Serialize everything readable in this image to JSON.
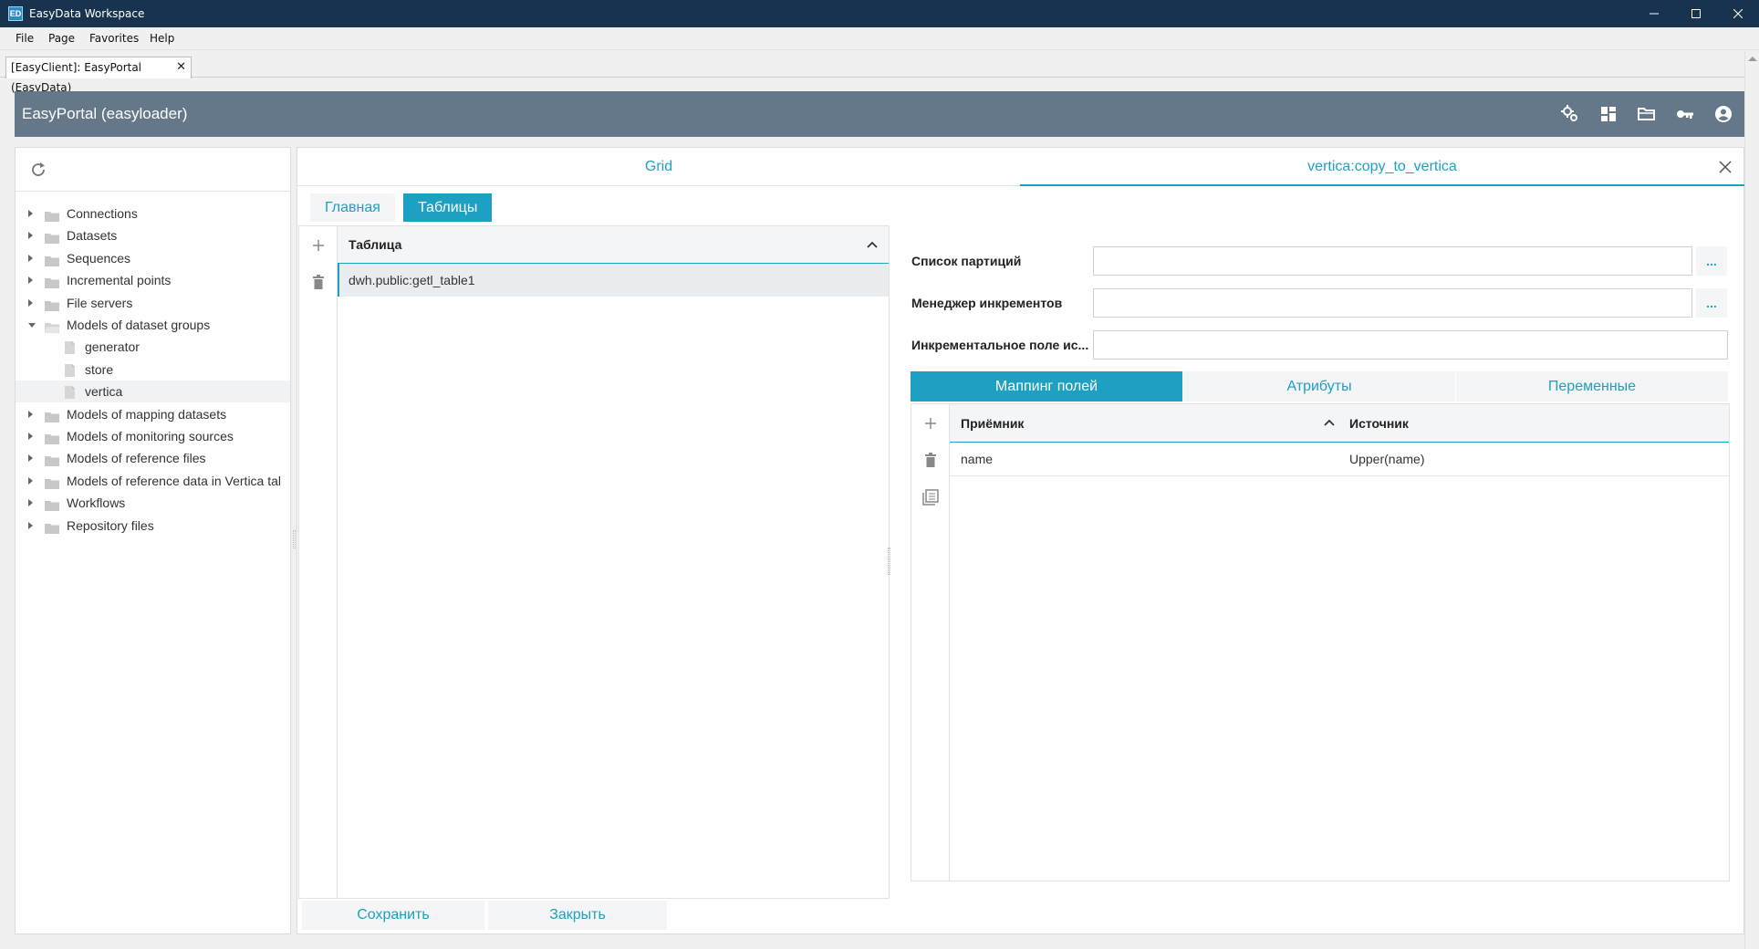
{
  "window": {
    "title": "EasyData Workspace",
    "icon_text": "ED"
  },
  "menu": [
    "File",
    "Page",
    "Favorites",
    "Help"
  ],
  "doc_tab": {
    "label": "[EasyClient]: EasyPortal (EasyData)",
    "close": "✕"
  },
  "header": {
    "title": "EasyPortal (easyloader)",
    "icons": [
      "settings-icon",
      "dashboard-icon",
      "folder-open-icon",
      "key-icon",
      "account-icon"
    ]
  },
  "tree": [
    {
      "label": "Connections",
      "type": "folder",
      "expanded": false,
      "level": 0
    },
    {
      "label": "Datasets",
      "type": "folder",
      "expanded": false,
      "level": 0
    },
    {
      "label": "Sequences",
      "type": "folder",
      "expanded": false,
      "level": 0
    },
    {
      "label": "Incremental points",
      "type": "folder",
      "expanded": false,
      "level": 0
    },
    {
      "label": "File servers",
      "type": "folder",
      "expanded": false,
      "level": 0
    },
    {
      "label": "Models of dataset groups",
      "type": "folder",
      "expanded": true,
      "level": 0
    },
    {
      "label": "generator",
      "type": "file",
      "level": 1
    },
    {
      "label": "store",
      "type": "file",
      "level": 1
    },
    {
      "label": "vertica",
      "type": "file",
      "level": 1,
      "selected": true
    },
    {
      "label": "Models of mapping datasets",
      "type": "folder",
      "expanded": false,
      "level": 0
    },
    {
      "label": "Models of monitoring sources",
      "type": "folder",
      "expanded": false,
      "level": 0
    },
    {
      "label": "Models of reference files",
      "type": "folder",
      "expanded": false,
      "level": 0
    },
    {
      "label": "Models of reference data in Vertica tal",
      "type": "folder",
      "expanded": false,
      "level": 0
    },
    {
      "label": "Workflows",
      "type": "folder",
      "expanded": false,
      "level": 0
    },
    {
      "label": "Repository files",
      "type": "folder",
      "expanded": false,
      "level": 0
    }
  ],
  "top_tabs": {
    "grid": "Grid",
    "active": "vertica:copy_to_vertica"
  },
  "sub_tabs": {
    "main": "Главная",
    "tables": "Таблицы"
  },
  "tables": {
    "header": "Таблица",
    "rows": [
      "dwh.public:getl_table1"
    ]
  },
  "form": {
    "partitions_label": "Список партиций",
    "partitions_value": "",
    "increment_manager_label": "Менеджер инкрементов",
    "increment_manager_value": "",
    "incremental_field_label": "Инкрементальное поле ис...",
    "incremental_field_value": "",
    "dots": "..."
  },
  "detail_tabs": {
    "mapping": "Маппинг полей",
    "attributes": "Атрибуты",
    "variables": "Переменные"
  },
  "mapping": {
    "col_target": "Приёмник",
    "col_source": "Источник",
    "rows": [
      {
        "target": "name",
        "source": "Upper(name)"
      }
    ]
  },
  "buttons": {
    "save": "Сохранить",
    "close": "Закрыть"
  },
  "colors": {
    "accent": "#1ea0c3",
    "titlebar": "#17334f",
    "app_header": "#64788a"
  }
}
